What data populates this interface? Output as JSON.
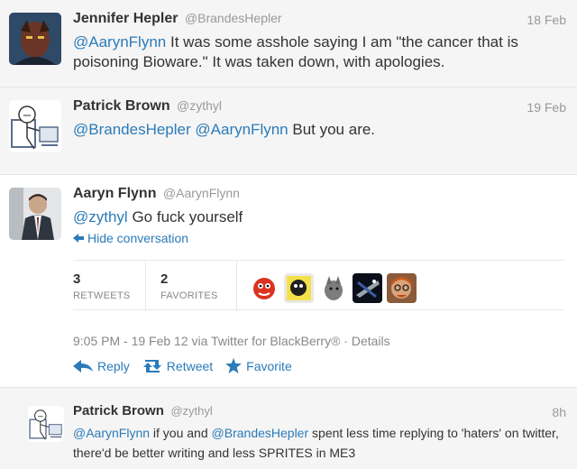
{
  "tweets": [
    {
      "name": "Jennifer Hepler",
      "handle": "@BrandesHepler",
      "time": "18 Feb",
      "text_parts": [
        "@AarynFlynn",
        " It was some asshole saying I am \"the cancer that is poisoning Bioware.\" It was taken down, with apologies."
      ]
    },
    {
      "name": "Patrick Brown",
      "handle": "@zythyl",
      "time": "19 Feb",
      "text_parts": [
        "@BrandesHepler",
        " ",
        "@AarynFlynn",
        " But you are."
      ]
    },
    {
      "name": "Aaryn Flynn",
      "handle": "@AarynFlynn",
      "text_parts": [
        "@zythyl",
        " Go fuck yourself"
      ],
      "hide_conversation": "Hide conversation",
      "retweets_count": "3",
      "retweets_label": "RETWEETS",
      "favorites_count": "2",
      "favorites_label": "FAVORITES",
      "meta": "9:05 PM - 19 Feb 12 via Twitter for BlackBerry® · ",
      "details": "Details",
      "actions": {
        "reply": "Reply",
        "retweet": "Retweet",
        "favorite": "Favorite"
      }
    },
    {
      "name": "Patrick Brown",
      "handle": "@zythyl",
      "time": "8h",
      "text_parts": [
        "@AarynFlynn",
        " if you and ",
        "@BrandesHepler",
        " spent less time replying to 'haters' on twitter, there'd be better writing and less SPRITES in ME3"
      ]
    }
  ],
  "colors": {
    "link": "#2b7bb9",
    "muted": "#999999",
    "text": "#333333",
    "background_muted": "#f5f5f5"
  },
  "icons": [
    "reply-icon",
    "retweet-icon",
    "favorite-star-icon",
    "hide-arrow-icon"
  ]
}
